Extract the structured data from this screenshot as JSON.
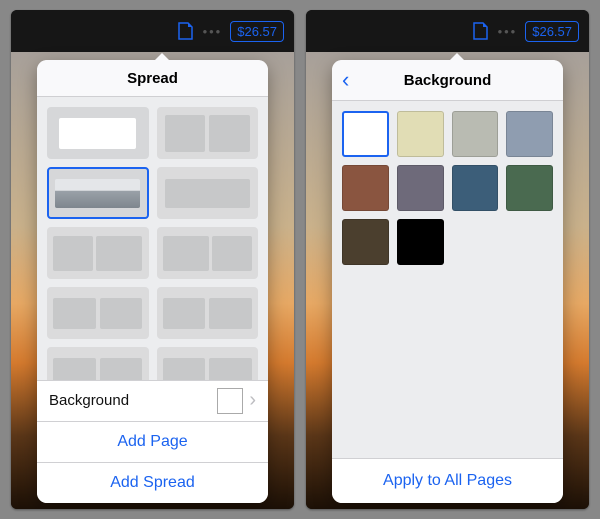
{
  "toolbar": {
    "price": "$26.57"
  },
  "left": {
    "header_title": "Spread",
    "background_row": "Background",
    "add_page": "Add Page",
    "add_spread": "Add Spread",
    "selected_layout_index": 2
  },
  "right": {
    "header_title": "Background",
    "apply_all": "Apply to All Pages",
    "selected_swatch_index": 0,
    "swatches": [
      "#ffffff",
      "#e1ddb5",
      "#b9bbb2",
      "#8f9db0",
      "#8a5540",
      "#6e6a7a",
      "#3c5e79",
      "#4a6a50",
      "#4b3f2e",
      "#000000"
    ]
  }
}
